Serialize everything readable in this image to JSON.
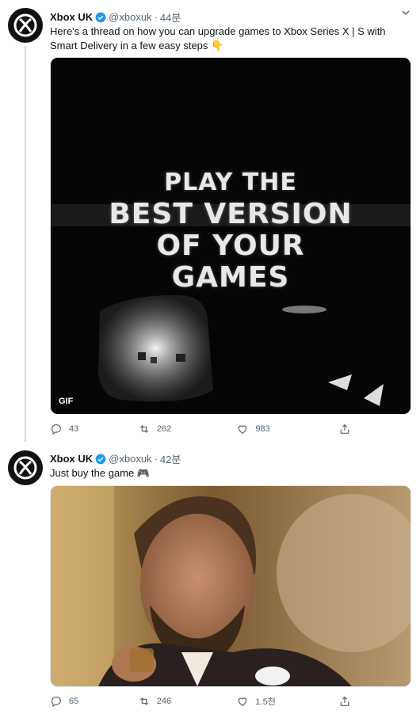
{
  "tweets": [
    {
      "author": "Xbox UK",
      "handle": "@xboxuk",
      "separator": "·",
      "time": "44분",
      "text": "Here's a thread on how you can upgrade games to Xbox Series X | S with Smart Delivery in a few easy steps 👇",
      "media": {
        "type": "gif",
        "badge": "GIF",
        "lines": [
          "PLAY THE",
          "BEST VERSION",
          "OF YOUR",
          "GAMES"
        ]
      },
      "replies": "43",
      "retweets": "262",
      "likes": "983"
    },
    {
      "author": "Xbox UK",
      "handle": "@xboxuk",
      "separator": "·",
      "time": "42분",
      "text": "Just buy the game 🎮",
      "media": {
        "type": "gif"
      },
      "replies": "65",
      "retweets": "246",
      "likes": "1.5천"
    }
  ],
  "colors": {
    "verified": "#1d9bf0",
    "thread_line": "#cfd9de",
    "muted": "#536471"
  },
  "icons": [
    "xbox-logo-icon",
    "verified-badge-icon",
    "chevron-down-icon",
    "reply-icon",
    "retweet-icon",
    "like-icon",
    "share-icon"
  ]
}
